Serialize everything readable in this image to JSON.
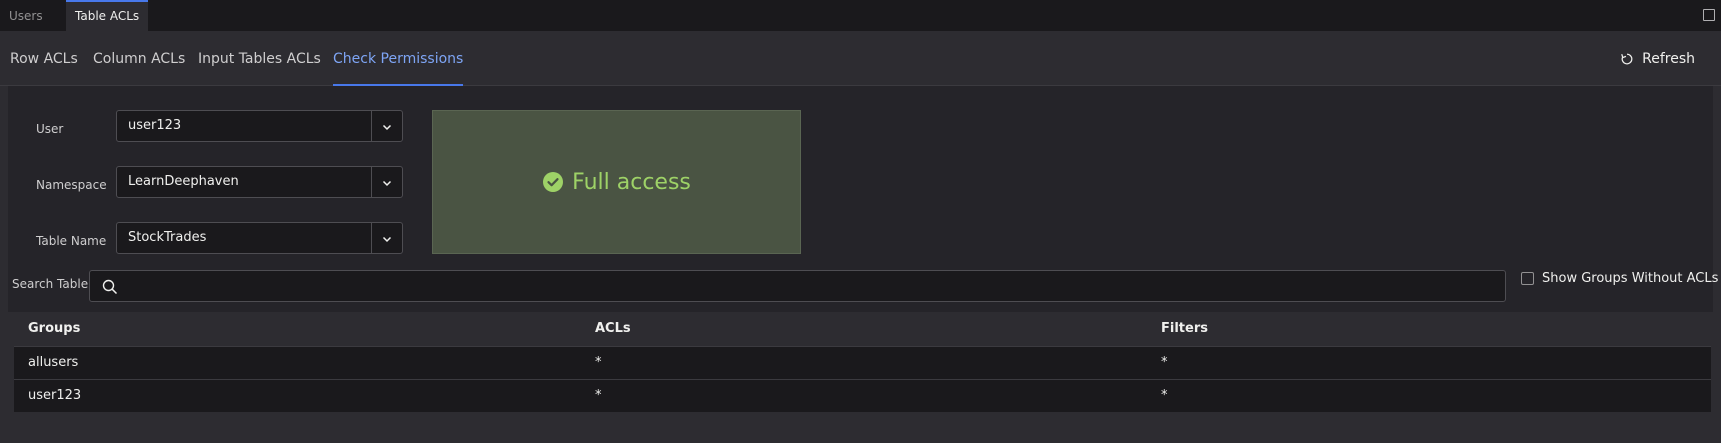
{
  "panel_tabs": [
    {
      "label": "Users",
      "active": false
    },
    {
      "label": "Table ACLs",
      "active": true
    }
  ],
  "sub_tabs": [
    {
      "label": "Row ACLs",
      "active": false
    },
    {
      "label": "Column ACLs",
      "active": false
    },
    {
      "label": "Input Tables ACLs",
      "active": false
    },
    {
      "label": "Check Permissions",
      "active": true
    }
  ],
  "refresh": {
    "label": "Refresh",
    "icon": "refresh-icon"
  },
  "form": {
    "user": {
      "label": "User",
      "value": "user123"
    },
    "namespace": {
      "label": "Namespace",
      "value": "LearnDeephaven"
    },
    "table_name": {
      "label": "Table Name",
      "value": "StockTrades"
    }
  },
  "result": {
    "text": "Full access",
    "icon": "check-circle-icon",
    "color": "#9ed267"
  },
  "search": {
    "label": "Search Table",
    "value": "",
    "placeholder": ""
  },
  "show_groups": {
    "label": "Show Groups Without ACLs",
    "checked": false
  },
  "table": {
    "columns": [
      "Groups",
      "ACLs",
      "Filters"
    ],
    "rows": [
      [
        "allusers",
        "*",
        "*"
      ],
      [
        "user123",
        "*",
        "*"
      ]
    ]
  },
  "colors": {
    "accent": "#4878ea",
    "success_bg": "#4a5443",
    "success_text": "#9ed267"
  }
}
